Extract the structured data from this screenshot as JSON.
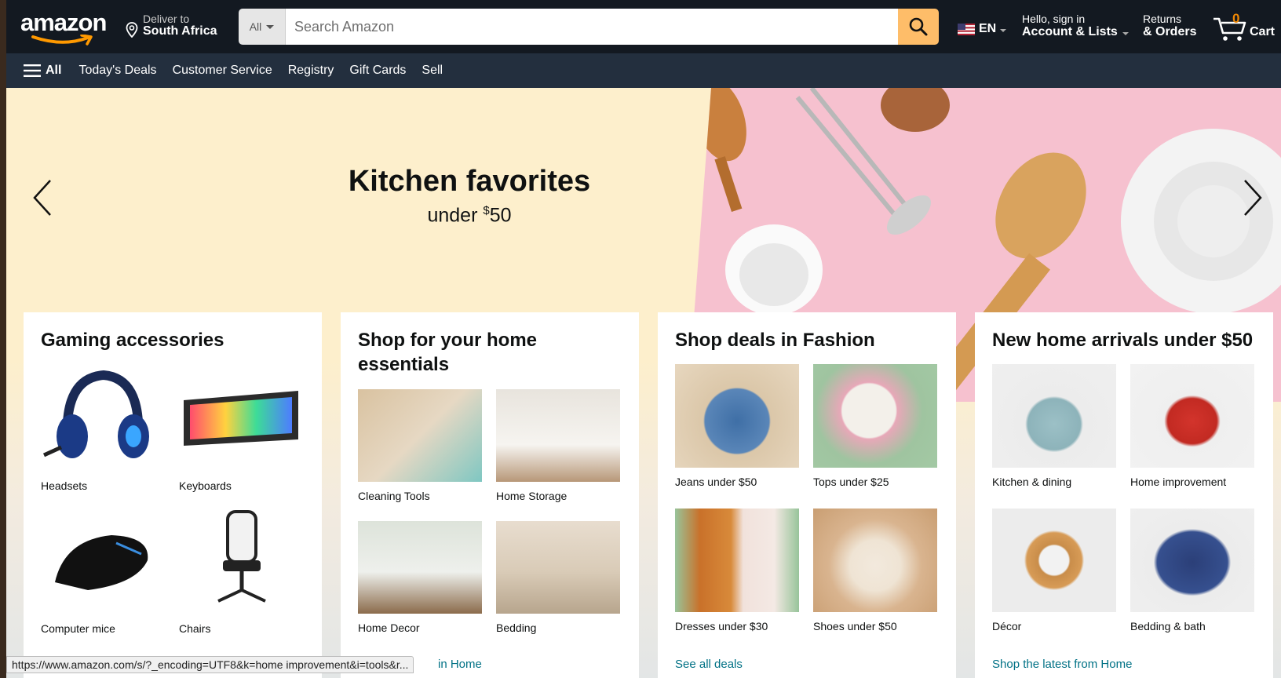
{
  "header": {
    "logo_text": "amazon",
    "deliver_line1": "Deliver to",
    "deliver_line2": "South Africa",
    "search_category": "All",
    "search_placeholder": "Search Amazon",
    "language": "EN",
    "account_line1": "Hello, sign in",
    "account_line2": "Account & Lists",
    "returns_line1": "Returns",
    "returns_line2": "& Orders",
    "cart_count": "0",
    "cart_label": "Cart",
    "colors": {
      "header_bg": "#131921",
      "nav_bg": "#232f3e",
      "search_button": "#febd69",
      "cart_count": "#f08804"
    }
  },
  "nav": {
    "all_label": "All",
    "items": [
      "Today's Deals",
      "Customer Service",
      "Registry",
      "Gift Cards",
      "Sell"
    ]
  },
  "hero": {
    "title": "Kitchen favorites",
    "subtitle_prefix": "under ",
    "subtitle_currency": "$",
    "subtitle_amount": "50",
    "prev_icon": "chevron-left-icon",
    "next_icon": "chevron-right-icon"
  },
  "cards": [
    {
      "title": "Gaming accessories",
      "tiles": [
        {
          "label": "Headsets",
          "icon": "headset-image"
        },
        {
          "label": "Keyboards",
          "icon": "keyboard-image"
        },
        {
          "label": "Computer mice",
          "icon": "mouse-image"
        },
        {
          "label": "Chairs",
          "icon": "chair-image"
        }
      ],
      "link": ""
    },
    {
      "title": "Shop for your home essentials",
      "tiles": [
        {
          "label": "Cleaning Tools",
          "icon": "cleaning-image"
        },
        {
          "label": "Home Storage",
          "icon": "storage-image"
        },
        {
          "label": "Home Decor",
          "icon": "decor-image"
        },
        {
          "label": "Bedding",
          "icon": "bedding-image"
        }
      ],
      "link": "in Home"
    },
    {
      "title": "Shop deals in Fashion",
      "tiles": [
        {
          "label": "Jeans under $50",
          "icon": "jeans-image"
        },
        {
          "label": "Tops under $25",
          "icon": "tops-image"
        },
        {
          "label": "Dresses under $30",
          "icon": "dresses-image"
        },
        {
          "label": "Shoes under $50",
          "icon": "shoes-image"
        }
      ],
      "link": "See all deals"
    },
    {
      "title": "New home arrivals under $50",
      "tiles": [
        {
          "label": "Kitchen & dining",
          "icon": "dutch-oven-image"
        },
        {
          "label": "Home improvement",
          "icon": "paint-cans-image"
        },
        {
          "label": "Décor",
          "icon": "mirror-image"
        },
        {
          "label": "Bedding & bath",
          "icon": "pillow-image"
        }
      ],
      "link": "Shop the latest from Home"
    }
  ],
  "status_url": "https://www.amazon.com/s/?_encoding=UTF8&k=home improvement&i=tools&r..."
}
